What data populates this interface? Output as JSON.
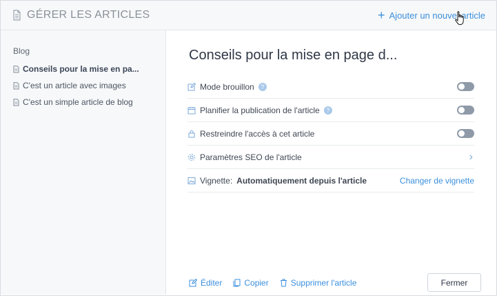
{
  "header": {
    "title": "GÉRER LES ARTICLES",
    "add_label": "Ajouter un nouvel article"
  },
  "sidebar": {
    "section_label": "Blog",
    "items": [
      {
        "label": "Conseils pour la mise en pa...",
        "active": true
      },
      {
        "label": "C'est un article avec images",
        "active": false
      },
      {
        "label": "C'est un simple article de blog",
        "active": false
      }
    ]
  },
  "main": {
    "article_title": "Conseils pour la mise en page d...",
    "settings": [
      {
        "label": "Mode brouillon",
        "help": "?"
      },
      {
        "label": "Planifier la publication de l'article",
        "help": "?"
      },
      {
        "label": "Restreindre l'accès à cet article"
      },
      {
        "label": "Paramètres SEO de l'article"
      },
      {
        "label": "Vignette:",
        "value": "Automatiquement depuis l'article",
        "action": "Changer de vignette"
      }
    ]
  },
  "footer": {
    "edit": "Éditer",
    "copy": "Copier",
    "delete": "Supprimer l'article",
    "close": "Fermer"
  },
  "colors": {
    "accent": "#3b8fdc",
    "toggle_off": "#8f9aa8"
  }
}
